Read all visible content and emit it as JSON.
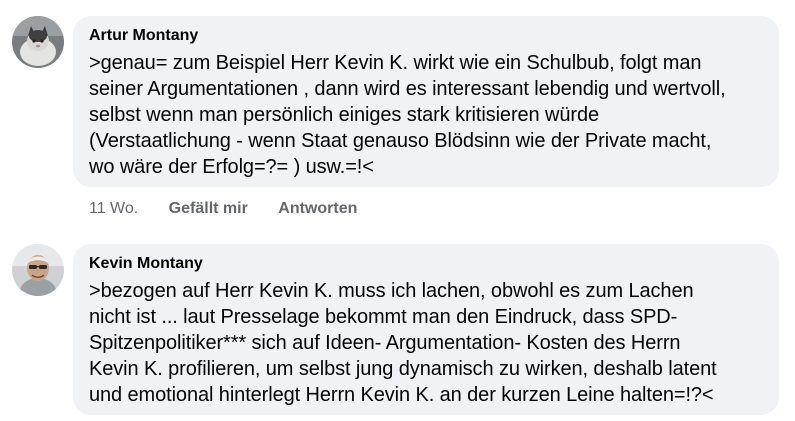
{
  "comments": [
    {
      "author": "Artur Montany",
      "avatar_icon": "cat-photo-avatar",
      "text": ">genau= zum Beispiel Herr Kevin K. wirkt wie ein Schulbub, folgt man\nseiner Argumentationen , dann wird es interessant lebendig und wertvoll,\nselbst wenn man persönlich einiges stark kritisieren würde\n(Verstaatlichung - wenn Staat genauso Blödsinn wie der Private macht,\nwo wäre der Erfolg=?= ) usw.=!<",
      "time": "11 Wo.",
      "like_label": "Gefällt mir",
      "reply_label": "Antworten"
    },
    {
      "author": "Kevin Montany",
      "avatar_icon": "person-photo-avatar",
      "text": ">bezogen auf Herr Kevin K. muss ich lachen, obwohl es zum Lachen\nnicht ist ... laut Presselage bekommt man den Eindruck, dass SPD-\nSpitzenpolitiker*** sich auf Ideen- Argumentation- Kosten des Herrn\nKevin K. profilieren, um selbst jung dynamisch zu wirken, deshalb latent\nund emotional hinterlegt Herrn Kevin K. an der kurzen Leine halten=!?<"
    }
  ],
  "colors": {
    "bubble_bg": "#f0f2f5",
    "text": "#050505",
    "secondary": "#65676b"
  }
}
